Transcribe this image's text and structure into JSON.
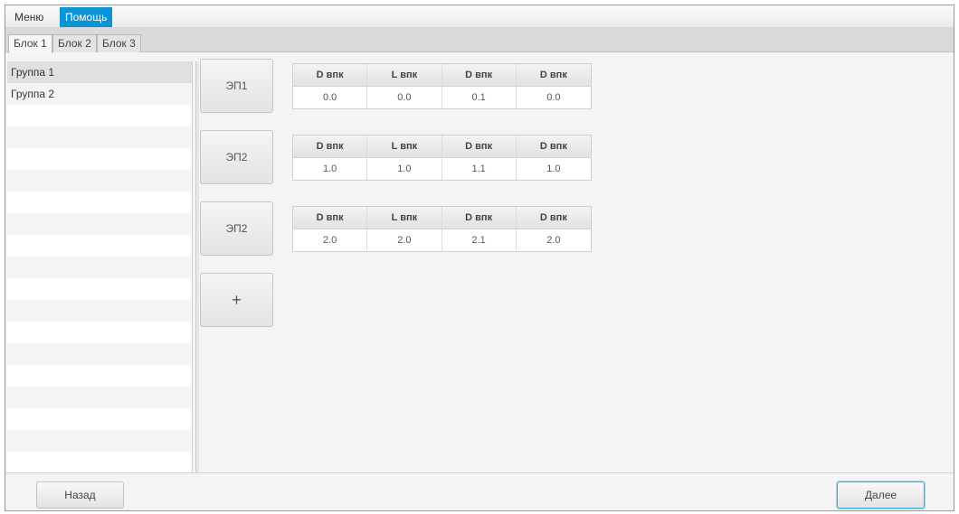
{
  "menubar": {
    "items": [
      {
        "label": "Меню"
      },
      {
        "label": "Помощь"
      }
    ]
  },
  "tabs": [
    {
      "label": "Блок 1"
    },
    {
      "label": "Блок 2"
    },
    {
      "label": "Блок 3"
    }
  ],
  "groups": [
    {
      "label": "Группа 1"
    },
    {
      "label": "Группа 2"
    }
  ],
  "elements": [
    {
      "button_label": "ЭП1",
      "headers": [
        "D впк",
        "L впк",
        "D впк",
        "D впк"
      ],
      "values": [
        "0.0",
        "0.0",
        "0.1",
        "0.0"
      ]
    },
    {
      "button_label": "ЭП2",
      "headers": [
        "D впк",
        "L впк",
        "D впк",
        "D впк"
      ],
      "values": [
        "1.0",
        "1.0",
        "1.1",
        "1.0"
      ]
    },
    {
      "button_label": "ЭП2",
      "headers": [
        "D впк",
        "L впк",
        "D впк",
        "D впк"
      ],
      "values": [
        "2.0",
        "2.0",
        "2.1",
        "2.0"
      ]
    }
  ],
  "add_button_label": "+",
  "footer": {
    "back_label": "Назад",
    "next_label": "Далее"
  },
  "colors": {
    "accent": "#0a94d6",
    "focus_border": "#3fa6d8"
  }
}
